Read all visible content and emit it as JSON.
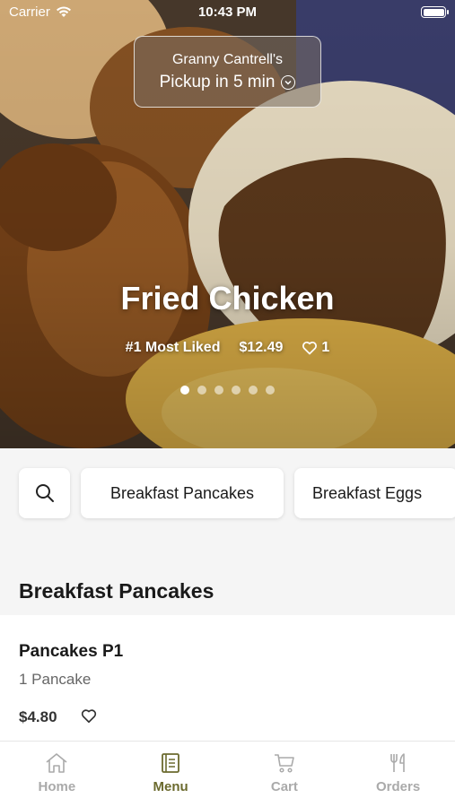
{
  "status_bar": {
    "carrier": "Carrier",
    "time": "10:43 PM"
  },
  "pickup": {
    "store": "Granny Cantrell's",
    "eta": "Pickup in 5 min"
  },
  "hero": {
    "title": "Fried Chicken",
    "badge": "#1 Most Liked",
    "price": "$12.49",
    "likes": "1",
    "carousel": {
      "count": 6,
      "active_index": 0
    }
  },
  "categories": {
    "search_icon": "search-icon",
    "items": [
      "Breakfast Pancakes",
      "Breakfast Eggs"
    ]
  },
  "section": {
    "title": "Breakfast Pancakes"
  },
  "menu_items": [
    {
      "name": "Pancakes P1",
      "description": "1 Pancake",
      "price": "$4.80"
    }
  ],
  "tab_bar": {
    "tabs": [
      {
        "label": "Home",
        "icon": "home-icon"
      },
      {
        "label": "Menu",
        "icon": "menu-book-icon"
      },
      {
        "label": "Cart",
        "icon": "cart-icon"
      },
      {
        "label": "Orders",
        "icon": "fork-knife-icon"
      }
    ],
    "active": "Menu"
  },
  "colors": {
    "accent": "#6b6a2e",
    "inactive": "#aaaaaa"
  }
}
